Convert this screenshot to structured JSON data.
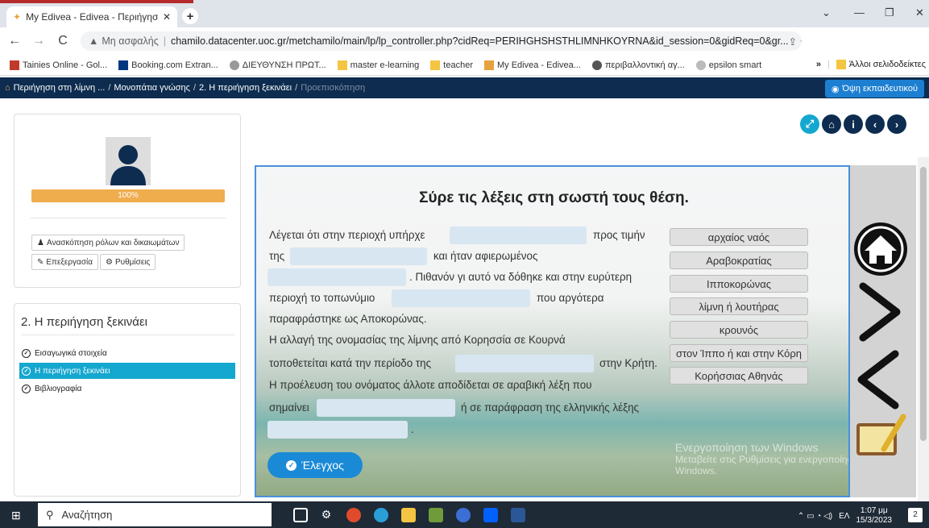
{
  "browser": {
    "tab_title": "My Edivea - Edivea - Περιήγηση",
    "tab_close": "✕",
    "new_tab": "+",
    "security_label": "Μη ασφαλής",
    "url": "chamilo.datacenter.uoc.gr/metchamilo/main/lp/lp_controller.php?cidReq=PERIHGHSHSTHLIMNHKOYRNA&id_session=0&gidReq=0&gr...",
    "bookmarks": [
      {
        "label": "Tainies Online - Gol..."
      },
      {
        "label": "Booking.com Extran..."
      },
      {
        "label": "ΔΙΕΥΘΥΝΣΗ ΠΡΩΤ..."
      },
      {
        "label": "master e-learning"
      },
      {
        "label": "teacher"
      },
      {
        "label": "My Edivea - Edivea..."
      },
      {
        "label": "περιβαλλοντική αγ..."
      },
      {
        "label": "epsilon smart"
      }
    ],
    "other_bookmarks": "Άλλοι σελιδοδείκτες",
    "more": "»"
  },
  "lp_header": {
    "crumb1": "Περιήγηση στη λίμνη ...",
    "crumb2": "Μονοπάτια γνώσης",
    "crumb3": "2. Η περιήγηση ξεκινάει",
    "crumb4": "Προεπισκόπηση",
    "sep": "/",
    "teacher_view": "Όψη εκπαιδευτικού"
  },
  "profile": {
    "progress_label": "100%",
    "progress_value": 100,
    "roles_button": "Ανασκόπηση ρόλων και δικαιωμάτων",
    "edit_button": "Επεξεργασία",
    "settings_button": "Ρυθμίσεις"
  },
  "toc": {
    "title": "2. Η περιήγηση ξεκινάει",
    "items": [
      {
        "label": "Εισαγωγικά στοιχεία",
        "active": false
      },
      {
        "label": "Η περιήγηση ξεκινάει",
        "active": true
      },
      {
        "label": "Βιβλιογραφία",
        "active": false
      }
    ]
  },
  "activity": {
    "title": "Σύρε τις λέξεις στη σωστή τους θέση.",
    "lines": {
      "l1a": "Λέγεται ότι στην περιοχή υπήρχε",
      "l1b": "προς τιμήν",
      "l2a": "της",
      "l2b": "και ήταν αφιερωμένος",
      "l3b": ". Πιθανόν γι αυτό να δόθηκε και στην ευρύτερη",
      "l4a": "περιοχή το τοπωνύμιο",
      "l4b": "που αργότερα",
      "l5": "παραφράστηκε ως Αποκορώνας.",
      "l6": "Η αλλαγή της ονομασίας της λίμνης από Κορησσία σε Κουρνά",
      "l7a": "τοποθετείται κατά την περίοδο της",
      "l7b": "στην Κρήτη.",
      "l8": "Η προέλευση του ονόματος άλλοτε αποδίδεται σε αραβική λέξη που",
      "l9a": "σημαίνει",
      "l9b": "ή σε παράφραση της ελληνικής λέξης",
      "l10b": "."
    },
    "words": [
      "αρχαίος ναός",
      "Αραβοκρατίας",
      "Ιπποκορώνας",
      "λίμνη ή λουτήρας",
      "κρουνός",
      "στον Ίππο ή και στην Κόρη",
      "Κορήσσιας Αθηνάς"
    ],
    "check_button": "Έλεγχος",
    "watermark_line1": "Ενεργοποίηση των Windows",
    "watermark_line2": "Μεταβείτε στις Ρυθμίσεις για ενεργοποίηση των",
    "watermark_line3": "Windows."
  },
  "taskbar": {
    "search_placeholder": "Αναζήτηση",
    "lang": "ΕΛ",
    "time": "1:07 μμ",
    "date": "15/3/2023",
    "notif_count": "2"
  },
  "colors": {
    "header_bg": "#0d2c4f",
    "accent_blue": "#14a7cf",
    "progress": "#f0ad4e",
    "check_button": "#1a8ad6"
  }
}
